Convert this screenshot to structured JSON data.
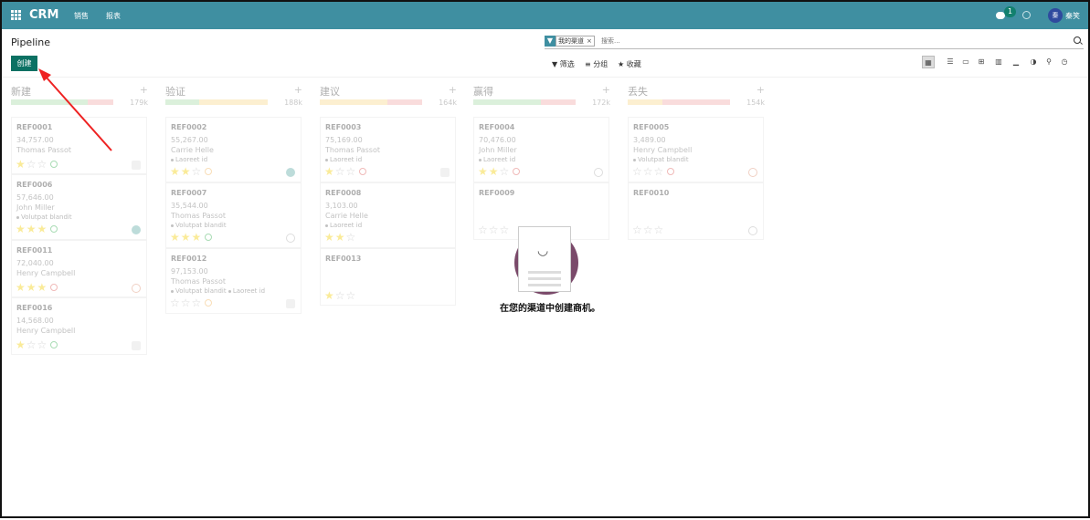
{
  "topbar": {
    "brand": "CRM",
    "menus": [
      "销售",
      "报表"
    ],
    "badge": "1",
    "user_avatar": "秦",
    "user_name": "秦笑"
  },
  "controlpanel": {
    "title": "Pipeline",
    "create_label": "创建",
    "facet_label": "我的渠道",
    "facet_remove": "×",
    "search_placeholder": "搜索...",
    "filters": "▼ 筛选",
    "groupby": "≡ 分组",
    "favorites": "★ 收藏"
  },
  "columns": [
    {
      "title": "新建",
      "total": "179k",
      "cards": [
        {
          "ref": "REF0001",
          "amount": "34,757.00",
          "name": "Thomas Passot",
          "tags": [],
          "stars": 1,
          "activity": "green",
          "assignee": "user"
        },
        {
          "ref": "REF0006",
          "amount": "57,646.00",
          "name": "John Miller",
          "tags": [
            "Volutpat blandit"
          ],
          "stars": 3,
          "activity": "green",
          "assignee": "av"
        },
        {
          "ref": "REF0011",
          "amount": "72,040.00",
          "name": "Henry Campbell",
          "tags": [],
          "stars": 3,
          "activity": "red",
          "assignee": "av3"
        },
        {
          "ref": "REF0016",
          "amount": "14,568.00",
          "name": "Henry Campbell",
          "tags": [],
          "stars": 1,
          "activity": "green",
          "assignee": "user"
        }
      ]
    },
    {
      "title": "验证",
      "total": "188k",
      "cards": [
        {
          "ref": "REF0002",
          "amount": "55,267.00",
          "name": "Carrie Helle",
          "tags": [
            "Laoreet id"
          ],
          "stars": 2,
          "activity": "orange",
          "assignee": "av"
        },
        {
          "ref": "REF0007",
          "amount": "35,544.00",
          "name": "Thomas Passot",
          "tags": [
            "Volutpat blandit"
          ],
          "stars": 3,
          "activity": "green",
          "assignee": "av2"
        },
        {
          "ref": "REF0012",
          "amount": "97,153.00",
          "name": "Thomas Passot",
          "tags": [
            "Volutpat blandit",
            "Laoreet id"
          ],
          "stars": 0,
          "activity": "orange",
          "assignee": "user"
        }
      ]
    },
    {
      "title": "建议",
      "total": "164k",
      "cards": [
        {
          "ref": "REF0003",
          "amount": "75,169.00",
          "name": "Thomas Passot",
          "tags": [
            "Laoreet id"
          ],
          "stars": 1,
          "activity": "red",
          "assignee": "user"
        },
        {
          "ref": "REF0008",
          "amount": "3,103.00",
          "name": "Carrie Helle",
          "tags": [
            "Laoreet id"
          ],
          "stars": 2,
          "activity": "",
          "assignee": ""
        },
        {
          "ref": "REF0013",
          "amount": "",
          "name": "",
          "tags": [],
          "stars": 1,
          "activity": "",
          "assignee": ""
        }
      ]
    },
    {
      "title": "赢得",
      "total": "172k",
      "cards": [
        {
          "ref": "REF0004",
          "amount": "70,476.00",
          "name": "John Miller",
          "tags": [
            "Laoreet id"
          ],
          "stars": 2,
          "activity": "red",
          "assignee": "av2"
        },
        {
          "ref": "REF0009",
          "amount": "",
          "name": "",
          "tags": [],
          "stars": 0,
          "activity": "",
          "assignee": ""
        }
      ]
    },
    {
      "title": "丢失",
      "total": "154k",
      "cards": [
        {
          "ref": "REF0005",
          "amount": "3,489.00",
          "name": "Henry Campbell",
          "tags": [
            "Volutpat blandit"
          ],
          "stars": 0,
          "activity": "red",
          "assignee": "av3"
        },
        {
          "ref": "REF0010",
          "amount": "",
          "name": "",
          "tags": [],
          "stars": 0,
          "activity": "",
          "assignee": "av2"
        }
      ]
    }
  ],
  "help": {
    "face": "◡",
    "text": "在您的渠道中创建商机。"
  }
}
